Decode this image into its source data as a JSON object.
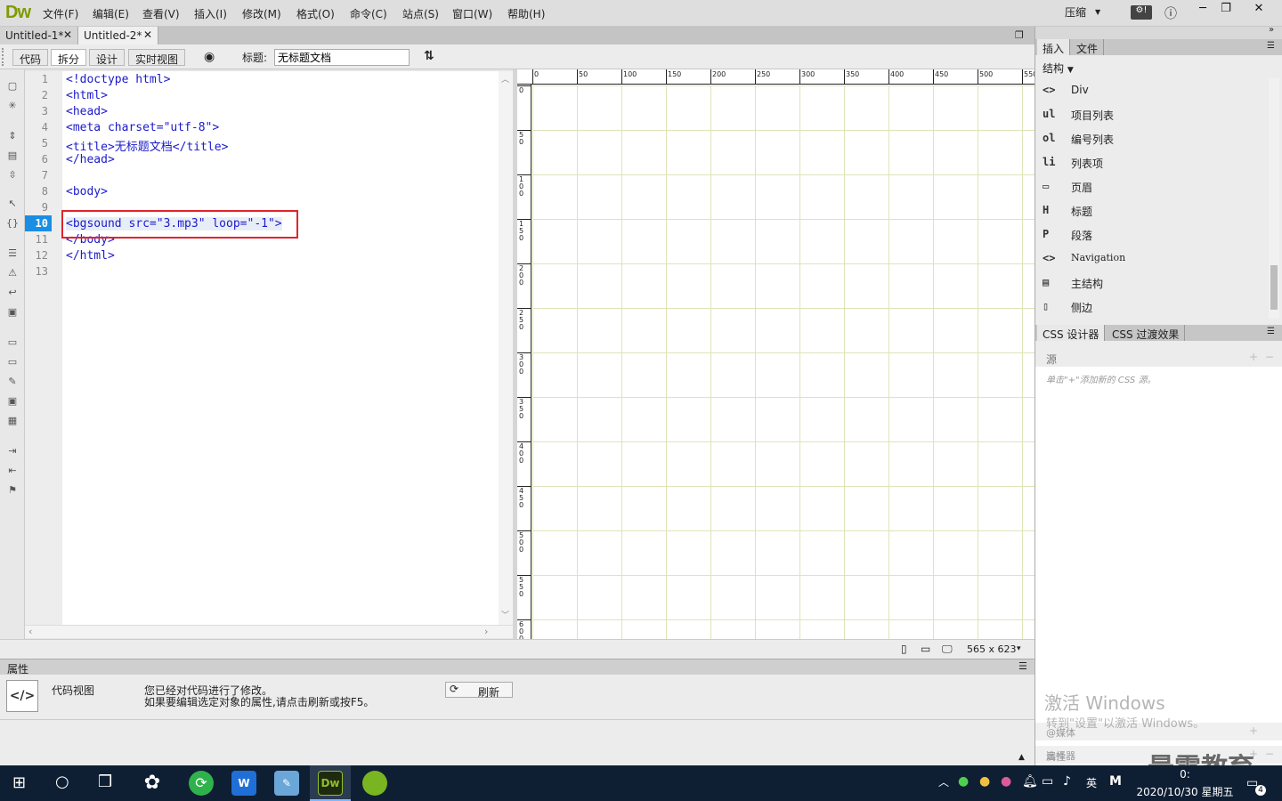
{
  "app": {
    "logo": "Dw",
    "menus": [
      "文件(F)",
      "编辑(E)",
      "查看(V)",
      "插入(I)",
      "修改(M)",
      "格式(O)",
      "命令(C)",
      "站点(S)",
      "窗口(W)",
      "帮助(H)"
    ],
    "compress": "压缩"
  },
  "tabs": [
    {
      "label": "Untitled-1*"
    },
    {
      "label": "Untitled-2*"
    }
  ],
  "toolbar": {
    "views": [
      "代码",
      "拆分",
      "设计",
      "实时视图"
    ],
    "title_label": "标题:",
    "title_value": "无标题文档"
  },
  "code": {
    "line_numbers": [
      "1",
      "2",
      "3",
      "4",
      "5",
      "6",
      "7",
      "8",
      "9",
      "10",
      "11",
      "12",
      "13"
    ],
    "active_line": "10",
    "lines": [
      "<!doctype html>",
      "<html>",
      "<head>",
      "<meta charset=\"utf-8\">",
      "<title>无标题文档</title>",
      "</head>",
      "",
      "<body>",
      "",
      "<bgsound src=\"3.mp3\" loop=\"-1\">",
      "</body>",
      "</html>",
      ""
    ]
  },
  "ruler": {
    "top_labels": [
      "0",
      "50",
      "100",
      "150",
      "200",
      "250",
      "300",
      "350",
      "400",
      "450",
      "500",
      "550"
    ],
    "left_labels": [
      "0",
      "50",
      "100",
      "150",
      "200",
      "250",
      "300",
      "350",
      "400",
      "450",
      "500",
      "550",
      "600"
    ]
  },
  "status": {
    "dimensions": "565 x 623"
  },
  "properties": {
    "header": "属性",
    "mode_label": "代码视图",
    "message_line1": "您已经对代码进行了修改。",
    "message_line2": "如果要编辑选定对象的属性,请点击刷新或按F5。",
    "refresh_label": "刷新"
  },
  "insert_panel": {
    "tabs": [
      "插入",
      "文件"
    ],
    "category": "结构",
    "items": [
      {
        "icon": "<>",
        "label": "Div"
      },
      {
        "icon": "ul",
        "label": "项目列表"
      },
      {
        "icon": "ol",
        "label": "编号列表"
      },
      {
        "icon": "li",
        "label": "列表项"
      },
      {
        "icon": "▭",
        "label": "页眉"
      },
      {
        "icon": "H",
        "label": "标题"
      },
      {
        "icon": "P",
        "label": "段落"
      },
      {
        "icon": "<>",
        "label": "Navigation"
      },
      {
        "icon": "▤",
        "label": "主结构"
      },
      {
        "icon": "▯",
        "label": "侧边"
      }
    ]
  },
  "css_panel": {
    "tabs": [
      "CSS 设计器",
      "CSS 过渡效果"
    ],
    "source_label": "源",
    "hint": "单击\"+\"添加新的 CSS 源。",
    "media_label": "@媒体",
    "selector_label": "选择器",
    "properties_label": "属性"
  },
  "watermark": {
    "activate_line1": "激活 Windows",
    "activate_line2": "转到\"设置\"以激活 Windows。",
    "brand": "最需教育"
  },
  "taskbar": {
    "ime": "英",
    "time": "0:",
    "date": "2020/10/30 星期五",
    "notification_count": "4"
  }
}
